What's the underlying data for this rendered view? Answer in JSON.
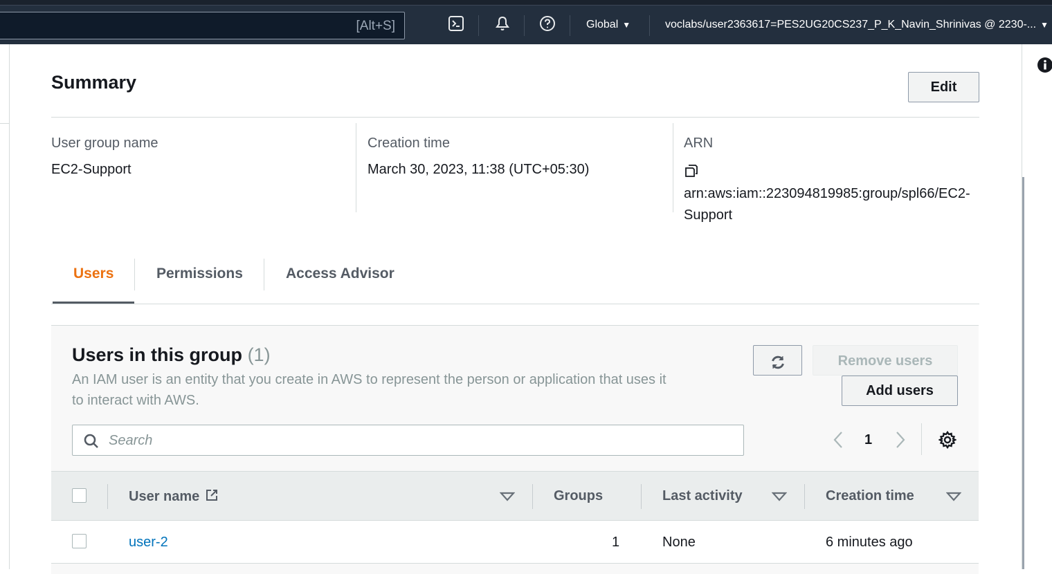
{
  "topbar": {
    "search_hint": "[Alt+S]",
    "icons": [
      "cloudshell-icon",
      "bell-icon",
      "help-icon"
    ],
    "region_label": "Global",
    "account_label": "voclabs/user2363617=PES2UG20CS237_P_K_Navin_Shrinivas @ 2230-..."
  },
  "summary": {
    "title": "Summary",
    "edit_label": "Edit",
    "group_name_label": "User group name",
    "group_name_value": "EC2-Support",
    "creation_label": "Creation time",
    "creation_value": "March 30, 2023, 11:38 (UTC+05:30)",
    "arn_label": "ARN",
    "arn_value": "arn:aws:iam::223094819985:group/spl66/EC2-Support"
  },
  "tabs": [
    {
      "label": "Users",
      "active": true
    },
    {
      "label": "Permissions",
      "active": false
    },
    {
      "label": "Access Advisor",
      "active": false
    }
  ],
  "users_panel": {
    "title": "Users in this group",
    "count": "(1)",
    "description": "An IAM user is an entity that you create in AWS to represent the person or application that uses it to interact with AWS.",
    "remove_label": "Remove users",
    "add_label": "Add users",
    "search_placeholder": "Search",
    "page_number": "1"
  },
  "table": {
    "columns": [
      "User name",
      "Groups",
      "Last activity",
      "Creation time"
    ],
    "rows": [
      {
        "user_name": "user-2",
        "groups": "1",
        "last_activity": "None",
        "creation_time": "6 minutes ago"
      }
    ]
  },
  "colors": {
    "topbar_bg": "#232f3e",
    "active_tab": "#ec7211",
    "link": "#0073bb",
    "panel_bg": "#f8f8f8"
  }
}
